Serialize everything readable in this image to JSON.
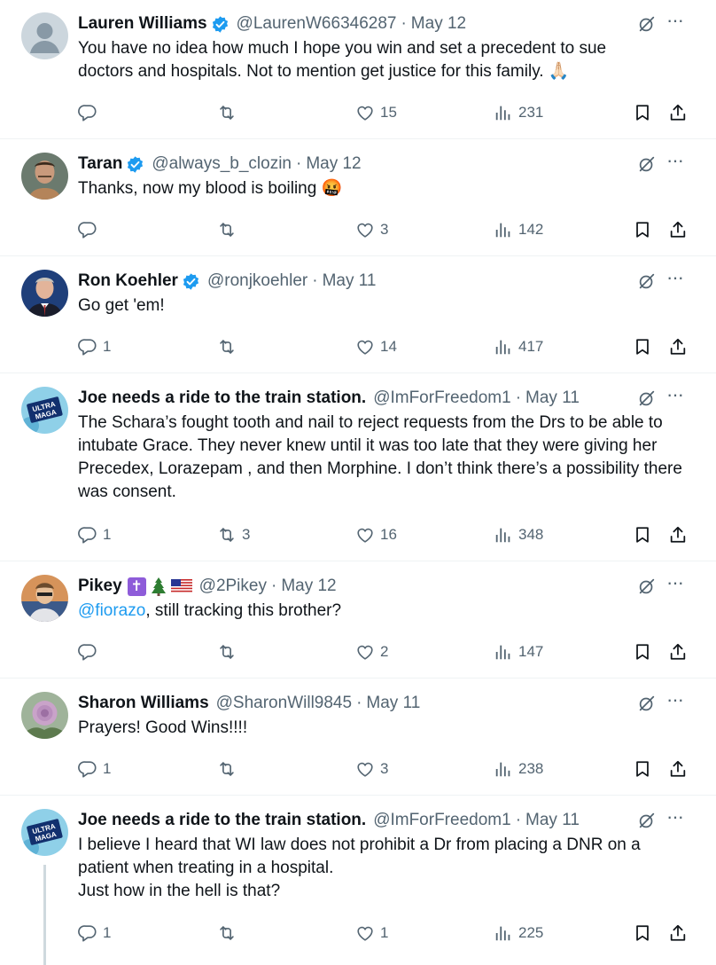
{
  "colors": {
    "link": "#1d9bf0",
    "verified": "#1d9bf0",
    "muted": "#536471",
    "thread_line": "#cfd9de"
  },
  "tweets": [
    {
      "name": "Lauren Williams",
      "verified": true,
      "handle": "@LaurenW66346287",
      "date": "May 12",
      "text": "You have no idea how much I hope you win and set a precedent to sue doctors and hospitals. Not to mention get justice for this family. 🙏🏻",
      "replies": "",
      "retweets": "",
      "likes": "15",
      "views": "231",
      "avatar": "default-avatar-icon"
    },
    {
      "name": "Taran",
      "verified": true,
      "handle": "@always_b_clozin",
      "date": "May 12",
      "text": "Thanks, now my blood is boiling 🤬",
      "replies": "",
      "retweets": "",
      "likes": "3",
      "views": "142",
      "avatar": "man-photo"
    },
    {
      "name": "Ron Koehler",
      "verified": true,
      "handle": "@ronjkoehler",
      "date": "May 11",
      "text": "Go get 'em!",
      "replies": "1",
      "retweets": "",
      "likes": "14",
      "views": "417",
      "avatar": "suit-photo"
    },
    {
      "name": "Joe needs a ride to the train station.",
      "verified": false,
      "handle": "@ImForFreedom1",
      "date": "May 11",
      "text": "The Schara’s fought tooth and nail to reject requests from the Drs to be able to intubate Grace. They never knew until it was too late that they were giving her Precedex, Lorazepam , and then Morphine. I don’t think there’s a possibility there was consent.",
      "replies": "1",
      "retweets": "3",
      "likes": "16",
      "views": "348",
      "avatar": "ultra-maga-logo",
      "avatar_text": [
        "ULTRA",
        "MAGA"
      ]
    },
    {
      "name": "Pikey",
      "verified": false,
      "badges": "✝",
      "handle": "@2Pikey",
      "date": "May 12",
      "mention": "@fiorazo",
      "text": ", still tracking this brother?",
      "replies": "",
      "retweets": "",
      "likes": "2",
      "views": "147",
      "avatar": "cartoon-photo"
    },
    {
      "name": "Sharon Williams",
      "verified": false,
      "handle": "@SharonWill9845",
      "date": "May 11",
      "text": "Prayers! Good Wins!!!!",
      "replies": "1",
      "retweets": "",
      "likes": "3",
      "views": "238",
      "avatar": "rose-photo"
    },
    {
      "name": "Joe needs a ride to the train station.",
      "verified": false,
      "handle": "@ImForFreedom1",
      "date": "May 11",
      "text_lines": [
        "I believe I heard that WI law does not prohibit a Dr from placing a DNR on a",
        "patient when treating in a hospital.",
        "Just how in the hell is that?"
      ],
      "replies": "1",
      "retweets": "",
      "likes": "1",
      "views": "225",
      "avatar": "ultra-maga-logo",
      "avatar_text": [
        "ULTRA",
        "MAGA"
      ]
    }
  ]
}
